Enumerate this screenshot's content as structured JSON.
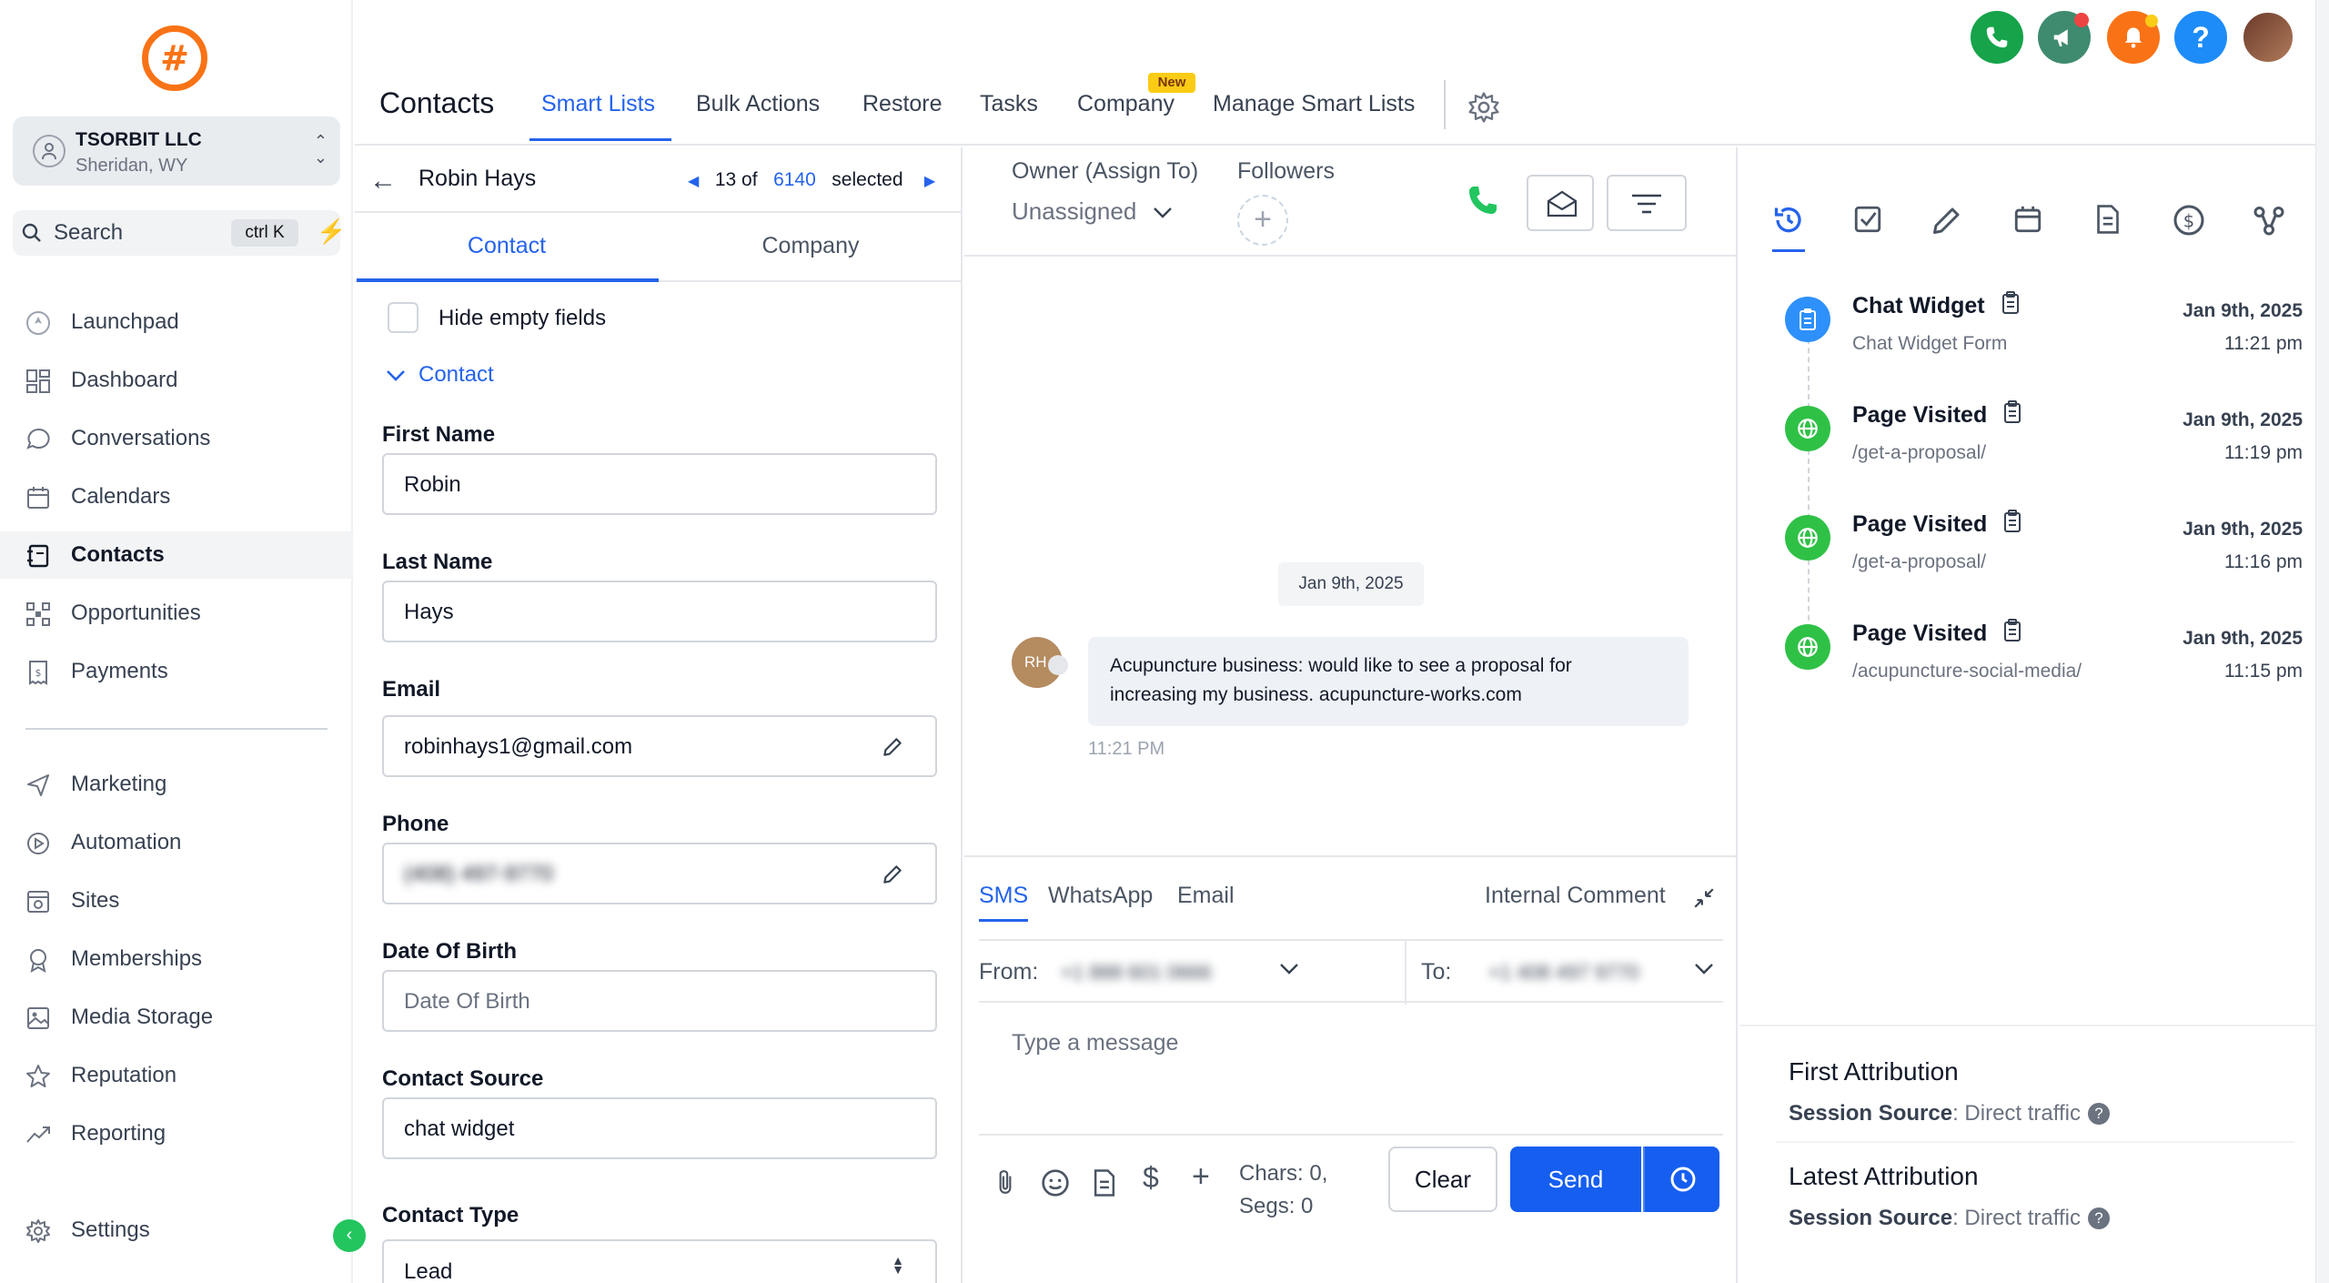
{
  "sidebar": {
    "account": {
      "name": "TSORBIT LLC",
      "location": "Sheridan, WY"
    },
    "search": {
      "label": "Search",
      "shortcut": "ctrl K"
    },
    "items": [
      {
        "label": "Launchpad",
        "icon": "rocket-icon"
      },
      {
        "label": "Dashboard",
        "icon": "dashboard-icon"
      },
      {
        "label": "Conversations",
        "icon": "chat-icon"
      },
      {
        "label": "Calendars",
        "icon": "calendar-icon"
      },
      {
        "label": "Contacts",
        "icon": "contacts-icon",
        "active": true
      },
      {
        "label": "Opportunities",
        "icon": "opportunities-icon"
      },
      {
        "label": "Payments",
        "icon": "payments-icon"
      },
      {
        "label": "Marketing",
        "icon": "send-icon"
      },
      {
        "label": "Automation",
        "icon": "automation-icon"
      },
      {
        "label": "Sites",
        "icon": "sites-icon"
      },
      {
        "label": "Memberships",
        "icon": "badge-icon"
      },
      {
        "label": "Media Storage",
        "icon": "image-icon"
      },
      {
        "label": "Reputation",
        "icon": "star-icon"
      },
      {
        "label": "Reporting",
        "icon": "trend-icon"
      },
      {
        "label": "Settings",
        "icon": "gear-icon"
      }
    ]
  },
  "topnav": {
    "title": "Contacts",
    "tabs": [
      "Smart Lists",
      "Bulk Actions",
      "Restore",
      "Tasks",
      "Company",
      "Manage Smart Lists"
    ],
    "active_tab": "Smart Lists",
    "new_badge": "New"
  },
  "record": {
    "name": "Robin Hays",
    "position": "13 of",
    "total": "6140",
    "selected_label": "selected",
    "tabs": [
      "Contact",
      "Company"
    ],
    "hide_empty_label": "Hide empty fields",
    "section": "Contact",
    "fields": {
      "first_name": {
        "label": "First Name",
        "value": "Robin"
      },
      "last_name": {
        "label": "Last Name",
        "value": "Hays"
      },
      "email": {
        "label": "Email",
        "value": "robinhays1@gmail.com"
      },
      "phone": {
        "label": "Phone",
        "value": "(408) 497-9770"
      },
      "dob": {
        "label": "Date Of Birth",
        "placeholder": "Date Of Birth"
      },
      "source": {
        "label": "Contact Source",
        "value": "chat widget"
      },
      "type": {
        "label": "Contact Type",
        "value": "Lead"
      }
    }
  },
  "conversation": {
    "owner_label": "Owner (Assign To)",
    "owner_value": "Unassigned",
    "followers_label": "Followers",
    "date_chip": "Jan 9th, 2025",
    "avatar_initials": "RH",
    "message_line1": "Acupuncture business: would like to see a proposal for",
    "message_line2": "increasing my business.  acupuncture-works.com",
    "message_time": "11:21 PM",
    "channels": [
      "SMS",
      "WhatsApp",
      "Email"
    ],
    "internal_comment": "Internal Comment",
    "from_label": "From:",
    "from_value": "+1 888 601 0666",
    "to_label": "To:",
    "to_value": "+1 408 497 9770",
    "input_placeholder": "Type a message",
    "chars": "Chars: 0,",
    "segs": "Segs: 0",
    "clear_label": "Clear",
    "send_label": "Send"
  },
  "activity": {
    "events": [
      {
        "title": "Chat Widget",
        "subtitle": "Chat Widget Form",
        "date": "Jan 9th, 2025",
        "time": "11:21 pm",
        "type": "form",
        "color": "#2e90fa"
      },
      {
        "title": "Page Visited",
        "subtitle": "/get-a-proposal/",
        "date": "Jan 9th, 2025",
        "time": "11:19 pm",
        "type": "globe",
        "color": "#2fc146"
      },
      {
        "title": "Page Visited",
        "subtitle": "/get-a-proposal/",
        "date": "Jan 9th, 2025",
        "time": "11:16 pm",
        "type": "globe",
        "color": "#2fc146"
      },
      {
        "title": "Page Visited",
        "subtitle": "/acupuncture-social-media/",
        "date": "Jan 9th, 2025",
        "time": "11:15 pm",
        "type": "globe",
        "color": "#2fc146"
      }
    ],
    "first_attribution": {
      "title": "First Attribution",
      "label": "Session Source",
      "value": ": Direct traffic"
    },
    "latest_attribution": {
      "title": "Latest Attribution",
      "label": "Session Source",
      "value": ": Direct traffic"
    }
  },
  "colors": {
    "accent": "#2563eb",
    "brand": "#f97316",
    "success": "#22c55e",
    "send": "#155eef"
  }
}
